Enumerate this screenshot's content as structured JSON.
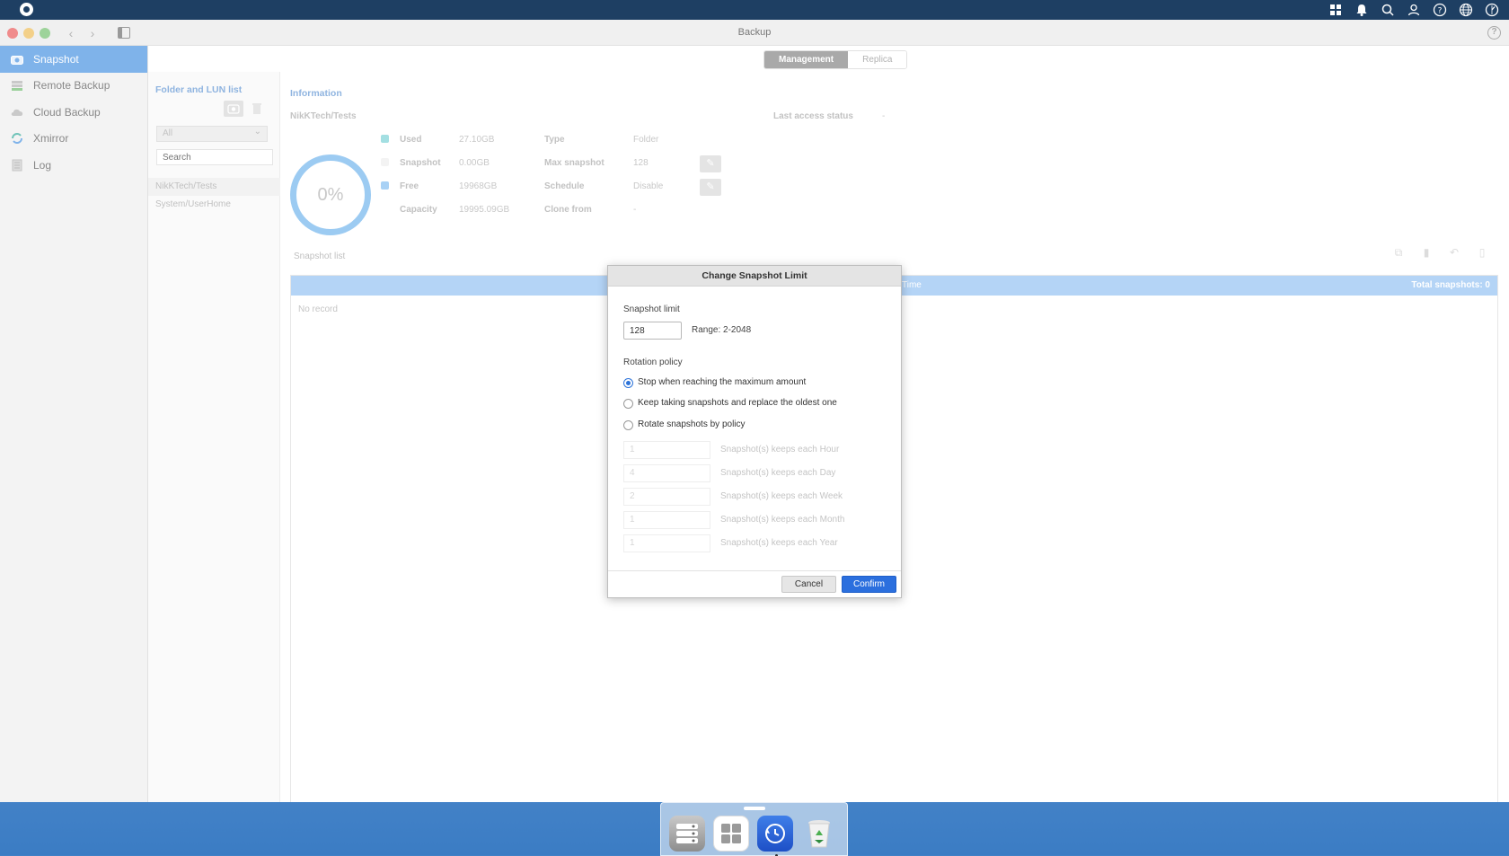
{
  "window": {
    "title": "Backup"
  },
  "sidebar": {
    "items": [
      {
        "label": "Snapshot",
        "icon": "camera-icon",
        "active": true
      },
      {
        "label": "Remote Backup",
        "icon": "server-icon",
        "active": false
      },
      {
        "label": "Cloud Backup",
        "icon": "cloud-icon",
        "active": false
      },
      {
        "label": "Xmirror",
        "icon": "sync-icon",
        "active": false
      },
      {
        "label": "Log",
        "icon": "document-icon",
        "active": false
      }
    ]
  },
  "tabs": {
    "management": "Management",
    "replica": "Replica"
  },
  "folder_panel": {
    "title": "Folder and LUN list",
    "filter": "All",
    "search_placeholder": "Search",
    "rows": [
      "NikKTech/Tests",
      "System/UserHome"
    ]
  },
  "information": {
    "title": "Information",
    "folder": "NikKTech/Tests",
    "percent": "0%",
    "used_label": "Used",
    "used_value": "27.10GB",
    "snapshot_label": "Snapshot",
    "snapshot_value": "0.00GB",
    "free_label": "Free",
    "free_value": "19968GB",
    "capacity_label": "Capacity",
    "capacity_value": "19995.09GB",
    "type_label": "Type",
    "type_value": "Folder",
    "max_snapshot_label": "Max snapshot",
    "max_snapshot_value": "128",
    "schedule_label": "Schedule",
    "schedule_value": "Disable",
    "clone_from_label": "Clone from",
    "clone_from_value": "-",
    "last_access_label": "Last access status",
    "last_access_value": "-"
  },
  "snapshot_list": {
    "title": "Snapshot list",
    "column_time": "Time",
    "total": "Total snapshots: 0",
    "empty": "No record"
  },
  "dialog": {
    "title": "Change Snapshot Limit",
    "limit_label": "Snapshot limit",
    "limit_value": "128",
    "range": "Range: 2-2048",
    "rotation_label": "Rotation policy",
    "options": [
      {
        "label": "Stop when reaching the maximum amount",
        "checked": true
      },
      {
        "label": "Keep taking snapshots and replace the oldest one",
        "checked": false
      },
      {
        "label": "Rotate snapshots by policy",
        "checked": false
      }
    ],
    "keeps": [
      {
        "value": "1",
        "label": "Snapshot(s) keeps each Hour"
      },
      {
        "value": "4",
        "label": "Snapshot(s) keeps each Day"
      },
      {
        "value": "2",
        "label": "Snapshot(s) keeps each Week"
      },
      {
        "value": "1",
        "label": "Snapshot(s) keeps each Month"
      },
      {
        "value": "1",
        "label": "Snapshot(s) keeps each Year"
      }
    ],
    "cancel": "Cancel",
    "confirm": "Confirm"
  },
  "colors": {
    "topbar": "#1e3f63",
    "accent": "#2b6fde",
    "sidebar_active": "#7fb3ea",
    "used": "#7fd3d9",
    "free": "#8fc2f0"
  }
}
